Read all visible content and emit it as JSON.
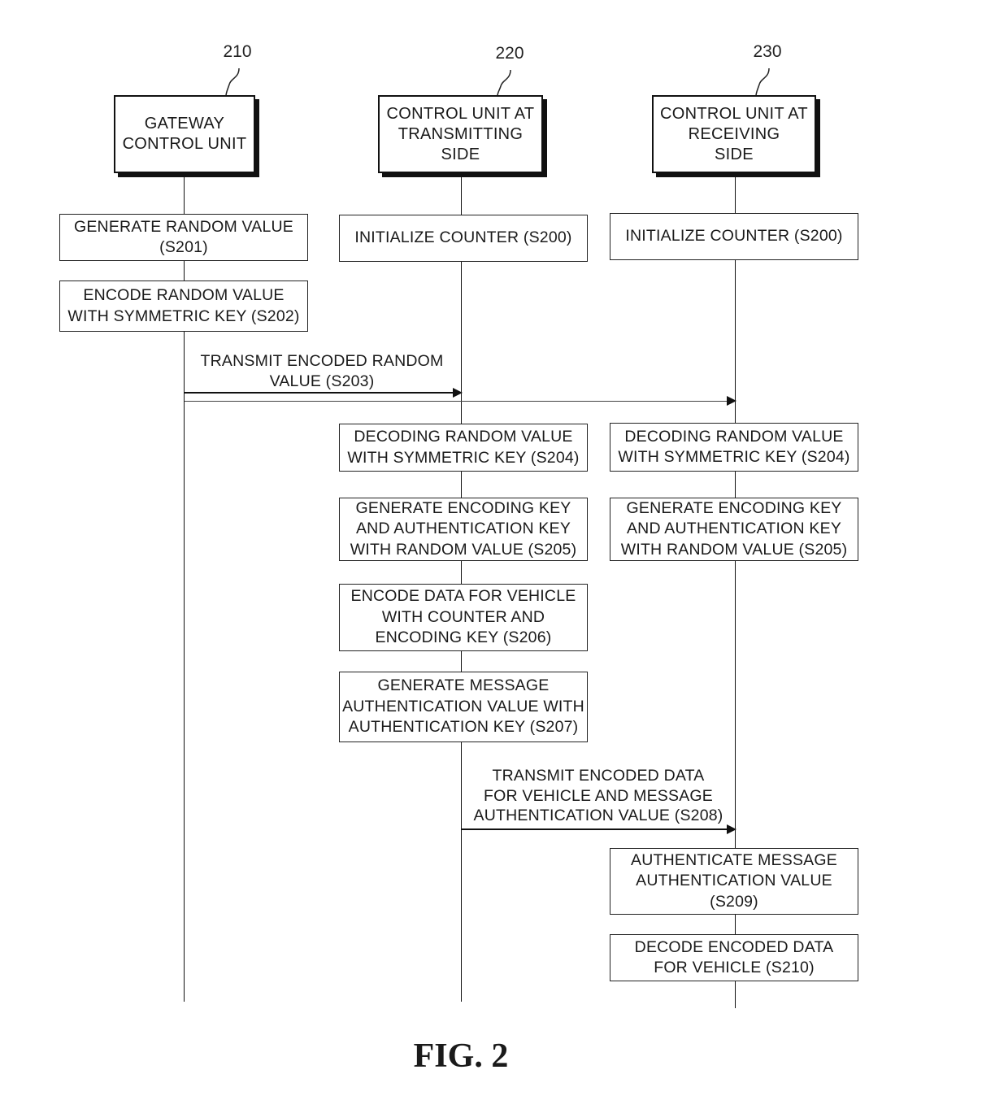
{
  "figure": {
    "caption": "FIG. 2"
  },
  "participants": [
    {
      "ref": "210",
      "label": "GATEWAY\nCONTROL UNIT"
    },
    {
      "ref": "220",
      "label": "CONTROL UNIT AT\nTRANSMITTING\nSIDE"
    },
    {
      "ref": "230",
      "label": "CONTROL UNIT AT\nRECEIVING\nSIDE"
    }
  ],
  "steps": {
    "gateway": [
      {
        "id": "S201",
        "text": "GENERATE RANDOM VALUE\n(S201)"
      },
      {
        "id": "S202",
        "text": "ENCODE RANDOM VALUE\nWITH SYMMETRIC KEY (S202)"
      }
    ],
    "transmitting": [
      {
        "id": "S200",
        "text": "INITIALIZE COUNTER (S200)"
      },
      {
        "id": "S204",
        "text": "DECODING RANDOM VALUE\nWITH SYMMETRIC KEY (S204)"
      },
      {
        "id": "S205",
        "text": "GENERATE ENCODING KEY\nAND AUTHENTICATION KEY\nWITH RANDOM VALUE (S205)"
      },
      {
        "id": "S206",
        "text": "ENCODE DATA FOR VEHICLE\nWITH COUNTER AND\nENCODING KEY (S206)"
      },
      {
        "id": "S207",
        "text": "GENERATE MESSAGE\nAUTHENTICATION VALUE WITH\nAUTHENTICATION KEY (S207)"
      }
    ],
    "receiving": [
      {
        "id": "S200",
        "text": "INITIALIZE COUNTER (S200)"
      },
      {
        "id": "S204",
        "text": "DECODING RANDOM VALUE\nWITH SYMMETRIC KEY (S204)"
      },
      {
        "id": "S205",
        "text": "GENERATE ENCODING KEY\nAND AUTHENTICATION KEY\nWITH RANDOM VALUE (S205)"
      },
      {
        "id": "S209",
        "text": "AUTHENTICATE MESSAGE\nAUTHENTICATION VALUE\n(S209)"
      },
      {
        "id": "S210",
        "text": "DECODE ENCODED DATA\nFOR VEHICLE (S210)"
      }
    ]
  },
  "messages": [
    {
      "id": "S203",
      "text": "TRANSMIT ENCODED RANDOM\nVALUE (S203)",
      "from": "210",
      "to": [
        "220",
        "230"
      ]
    },
    {
      "id": "S208",
      "text": "TRANSMIT ENCODED DATA\nFOR VEHICLE AND MESSAGE\nAUTHENTICATION VALUE (S208)",
      "from": "220",
      "to": [
        "230"
      ]
    }
  ]
}
